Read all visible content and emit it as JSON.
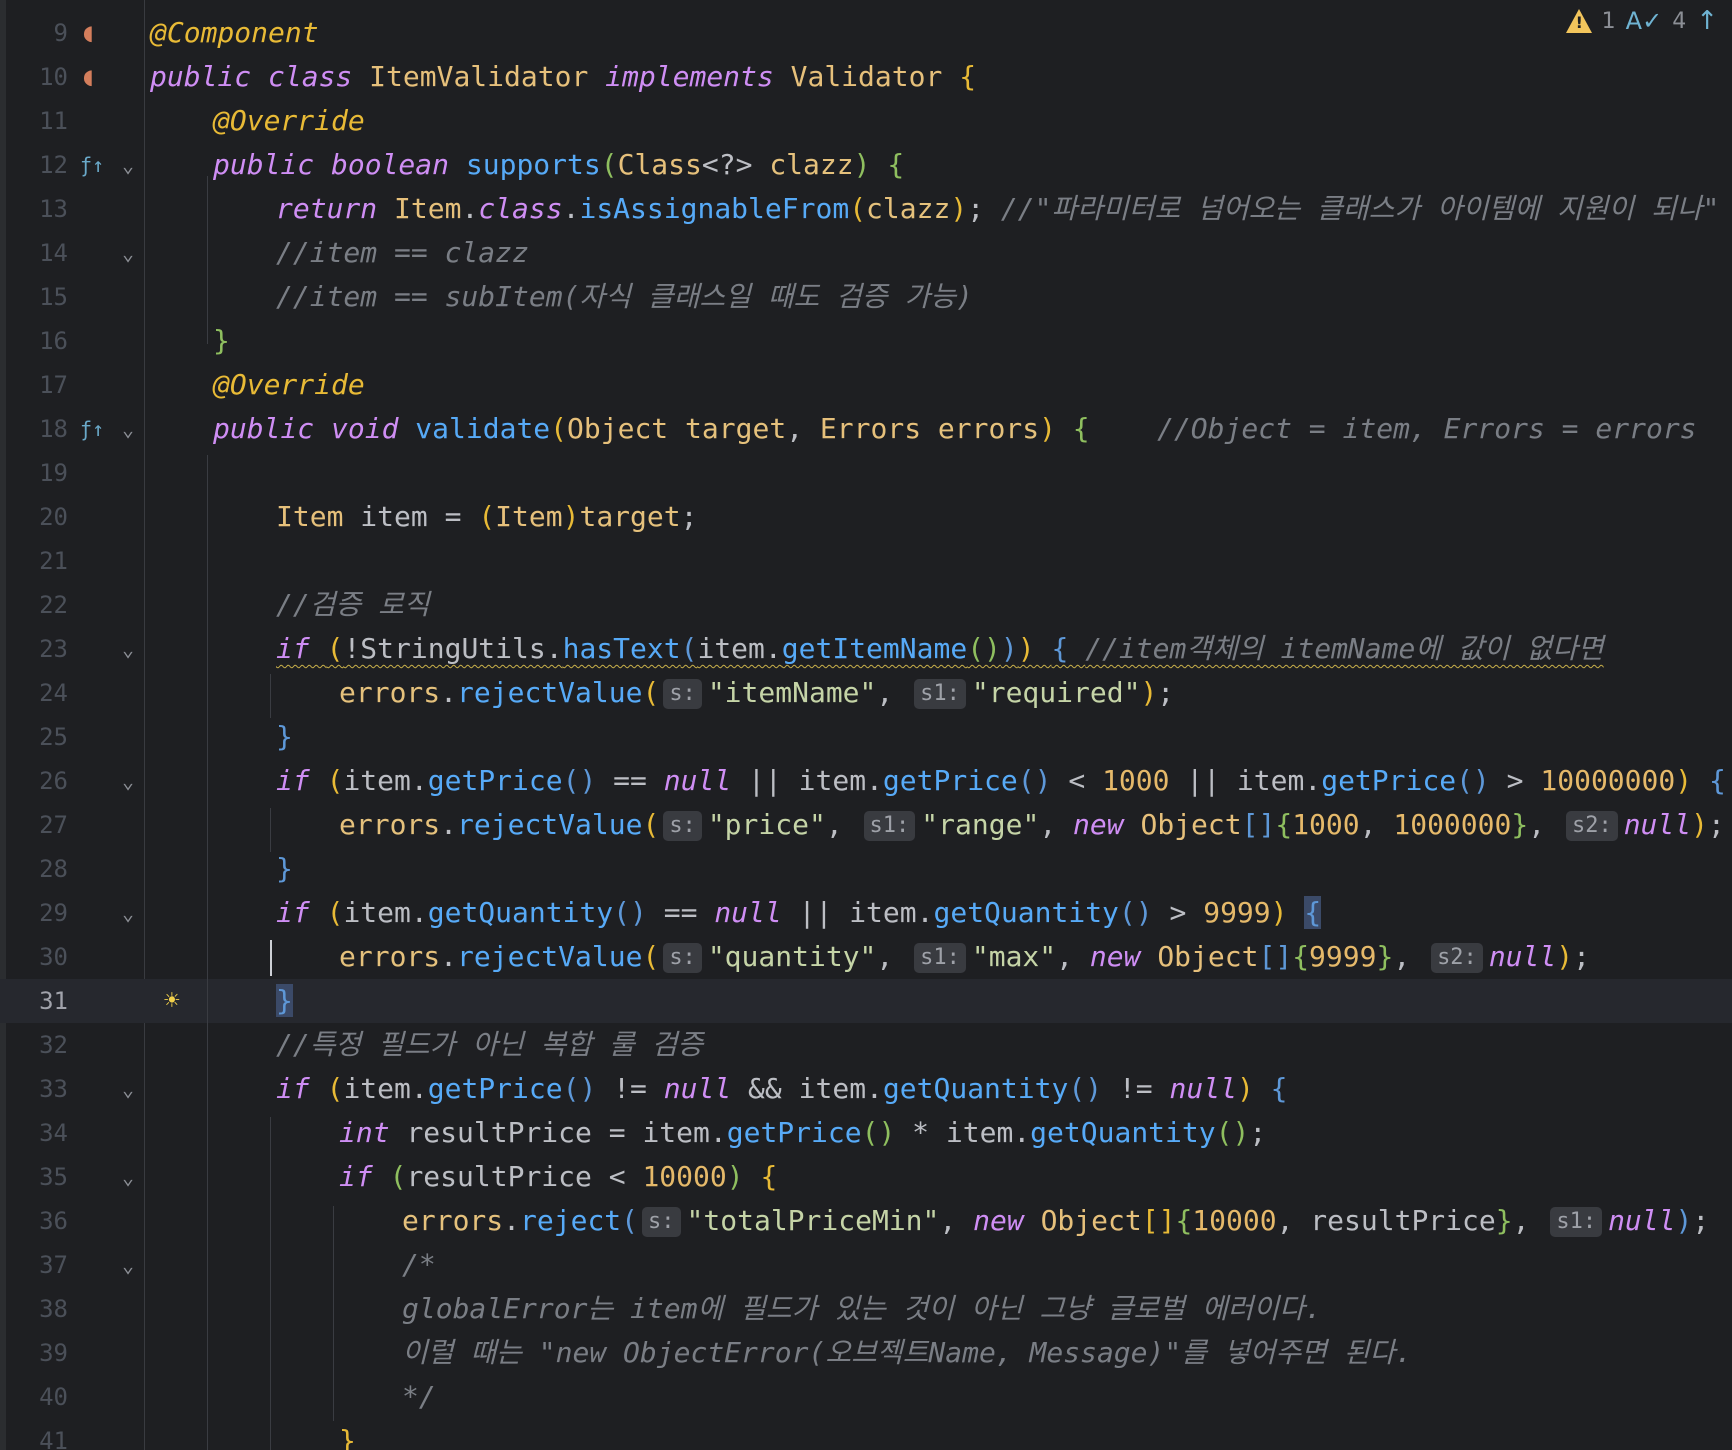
{
  "status": {
    "warnings": "1",
    "typos": "4",
    "warning_icon": "warning-triangle-icon",
    "typo_icon": "spellcheck-icon",
    "nav_icon": "arrow-up-icon"
  },
  "lines": [
    {
      "n": "9",
      "indent": 0,
      "gutter": "bean-icon",
      "fold": false,
      "tokens": [
        [
          "ann",
          "@Component"
        ]
      ]
    },
    {
      "n": "10",
      "indent": 0,
      "gutter": "bean-implemented-icon",
      "fold": false,
      "tokens": [
        [
          "kw",
          "public class "
        ],
        [
          "cls",
          "ItemValidator "
        ],
        [
          "kw",
          "implements "
        ],
        [
          "cls",
          "Validator "
        ],
        [
          "brace",
          "{"
        ]
      ]
    },
    {
      "n": "11",
      "indent": 1,
      "gutter": "",
      "fold": false,
      "tokens": [
        [
          "ann",
          "@Override"
        ]
      ]
    },
    {
      "n": "12",
      "indent": 1,
      "gutter": "override-method-icon",
      "fold": true,
      "tokens": [
        [
          "kw",
          "public boolean "
        ],
        [
          "fn",
          "supports"
        ],
        [
          "brace3",
          "("
        ],
        [
          "cls",
          "Class"
        ],
        [
          "plain",
          "<?> "
        ],
        [
          "param",
          "clazz"
        ],
        [
          "brace3",
          ") "
        ],
        [
          "brace3",
          "{"
        ]
      ]
    },
    {
      "n": "13",
      "indent": 2,
      "gutter": "",
      "fold": false,
      "tokens": [
        [
          "kw",
          "return "
        ],
        [
          "cls",
          "Item"
        ],
        [
          "plain",
          "."
        ],
        [
          "kw",
          "class"
        ],
        [
          "plain",
          "."
        ],
        [
          "fn",
          "isAssignableFrom"
        ],
        [
          "brace",
          "("
        ],
        [
          "param",
          "clazz"
        ],
        [
          "brace",
          ")"
        ],
        [
          "plain",
          "; "
        ],
        [
          "cm",
          "//\"파라미터로 넘어오는 클래스가 아이템에 지원이 되나\""
        ]
      ]
    },
    {
      "n": "14",
      "indent": 2,
      "gutter": "",
      "fold": true,
      "tokens": [
        [
          "cm",
          "//item == clazz"
        ]
      ]
    },
    {
      "n": "15",
      "indent": 2,
      "gutter": "",
      "fold": false,
      "tokens": [
        [
          "cm",
          "//item == subItem(자식 클래스일 때도 검증 가능)"
        ]
      ]
    },
    {
      "n": "16",
      "indent": 1,
      "gutter": "",
      "fold": false,
      "tokens": [
        [
          "brace3",
          "}"
        ]
      ]
    },
    {
      "n": "17",
      "indent": 1,
      "gutter": "",
      "fold": false,
      "tokens": [
        [
          "ann",
          "@Override"
        ]
      ]
    },
    {
      "n": "18",
      "indent": 1,
      "gutter": "override-method-icon",
      "fold": true,
      "tokens": [
        [
          "kw",
          "public void "
        ],
        [
          "fn",
          "validate"
        ],
        [
          "brace",
          "("
        ],
        [
          "cls",
          "Object "
        ],
        [
          "param",
          "target"
        ],
        [
          "plain",
          ", "
        ],
        [
          "cls",
          "Errors "
        ],
        [
          "param",
          "errors"
        ],
        [
          "brace",
          ") "
        ],
        [
          "brace3",
          "{"
        ],
        [
          "plain",
          "    "
        ],
        [
          "cm",
          "//Object = item, Errors = errors"
        ]
      ]
    },
    {
      "n": "19",
      "indent": 2,
      "gutter": "",
      "fold": false,
      "tokens": []
    },
    {
      "n": "20",
      "indent": 2,
      "gutter": "",
      "fold": false,
      "tokens": [
        [
          "cls",
          "Item "
        ],
        [
          "plain",
          "item = "
        ],
        [
          "brace",
          "("
        ],
        [
          "cls",
          "Item"
        ],
        [
          "brace",
          ")"
        ],
        [
          "param",
          "target"
        ],
        [
          "plain",
          ";"
        ]
      ]
    },
    {
      "n": "21",
      "indent": 2,
      "gutter": "",
      "fold": false,
      "tokens": []
    },
    {
      "n": "22",
      "indent": 2,
      "gutter": "",
      "fold": false,
      "tokens": [
        [
          "cm",
          "//검증 로직"
        ]
      ]
    },
    {
      "n": "23",
      "indent": 2,
      "gutter": "",
      "fold": true,
      "squiggle": true,
      "tokens": [
        [
          "kw",
          "if "
        ],
        [
          "brace",
          "("
        ],
        [
          "plain",
          "!StringUtils."
        ],
        [
          "fn",
          "hasText"
        ],
        [
          "brace2",
          "("
        ],
        [
          "plain",
          "item."
        ],
        [
          "fn",
          "getItemName"
        ],
        [
          "brace3",
          "()"
        ],
        [
          "brace2",
          ")"
        ],
        [
          "brace",
          ") "
        ],
        [
          "brace2",
          "{ "
        ],
        [
          "cm",
          "//item객체의 itemName에 값이 없다면"
        ]
      ]
    },
    {
      "n": "24",
      "indent": 3,
      "gutter": "",
      "fold": false,
      "tokens": [
        [
          "param",
          "errors"
        ],
        [
          "plain",
          "."
        ],
        [
          "fn",
          "rejectValue"
        ],
        [
          "brace",
          "("
        ],
        [
          "hint",
          "s:"
        ],
        [
          "str",
          "\"itemName\""
        ],
        [
          "plain",
          ", "
        ],
        [
          "hint",
          "s1:"
        ],
        [
          "str",
          "\"required\""
        ],
        [
          "brace",
          ")"
        ],
        [
          "plain",
          ";"
        ]
      ]
    },
    {
      "n": "25",
      "indent": 2,
      "gutter": "",
      "fold": false,
      "tokens": [
        [
          "brace2",
          "}"
        ]
      ]
    },
    {
      "n": "26",
      "indent": 2,
      "gutter": "",
      "fold": true,
      "tokens": [
        [
          "kw",
          "if "
        ],
        [
          "brace",
          "("
        ],
        [
          "plain",
          "item."
        ],
        [
          "fn",
          "getPrice"
        ],
        [
          "brace2",
          "()"
        ],
        [
          "plain",
          " == "
        ],
        [
          "kw",
          "null"
        ],
        [
          "plain",
          " || item."
        ],
        [
          "fn",
          "getPrice"
        ],
        [
          "brace2",
          "()"
        ],
        [
          "plain",
          " < "
        ],
        [
          "num",
          "1000"
        ],
        [
          "plain",
          " || item."
        ],
        [
          "fn",
          "getPrice"
        ],
        [
          "brace2",
          "()"
        ],
        [
          "plain",
          " > "
        ],
        [
          "num",
          "10000000"
        ],
        [
          "brace",
          ") "
        ],
        [
          "brace2",
          "{"
        ]
      ]
    },
    {
      "n": "27",
      "indent": 3,
      "gutter": "",
      "fold": false,
      "tokens": [
        [
          "param",
          "errors"
        ],
        [
          "plain",
          "."
        ],
        [
          "fn",
          "rejectValue"
        ],
        [
          "brace",
          "("
        ],
        [
          "hint",
          "s:"
        ],
        [
          "str",
          "\"price\""
        ],
        [
          "plain",
          ", "
        ],
        [
          "hint",
          "s1:"
        ],
        [
          "str",
          "\"range\""
        ],
        [
          "plain",
          ", "
        ],
        [
          "kw",
          "new "
        ],
        [
          "cls",
          "Object"
        ],
        [
          "brace2",
          "[]"
        ],
        [
          "brace3",
          "{"
        ],
        [
          "num",
          "1000"
        ],
        [
          "plain",
          ", "
        ],
        [
          "num",
          "1000000"
        ],
        [
          "brace3",
          "}"
        ],
        [
          "plain",
          ", "
        ],
        [
          "hint",
          "s2:"
        ],
        [
          "kw",
          "null"
        ],
        [
          "brace",
          ")"
        ],
        [
          "plain",
          ";"
        ]
      ]
    },
    {
      "n": "28",
      "indent": 2,
      "gutter": "",
      "fold": false,
      "tokens": [
        [
          "brace2",
          "}"
        ]
      ]
    },
    {
      "n": "29",
      "indent": 2,
      "gutter": "",
      "fold": true,
      "tokens": [
        [
          "kw",
          "if "
        ],
        [
          "brace",
          "("
        ],
        [
          "plain",
          "item."
        ],
        [
          "fn",
          "getQuantity"
        ],
        [
          "brace2",
          "()"
        ],
        [
          "plain",
          " == "
        ],
        [
          "kw",
          "null"
        ],
        [
          "plain",
          " || item."
        ],
        [
          "fn",
          "getQuantity"
        ],
        [
          "brace2",
          "()"
        ],
        [
          "plain",
          " > "
        ],
        [
          "num",
          "9999"
        ],
        [
          "brace",
          ") "
        ],
        [
          "bracehl",
          "{"
        ]
      ]
    },
    {
      "n": "30",
      "indent": 3,
      "gutter": "",
      "fold": false,
      "tokens": [
        [
          "param",
          "errors"
        ],
        [
          "plain",
          "."
        ],
        [
          "fn",
          "rejectValue"
        ],
        [
          "brace",
          "("
        ],
        [
          "hint",
          "s:"
        ],
        [
          "str",
          "\"quantity\""
        ],
        [
          "plain",
          ", "
        ],
        [
          "hint",
          "s1:"
        ],
        [
          "str",
          "\"max\""
        ],
        [
          "plain",
          ", "
        ],
        [
          "kw",
          "new "
        ],
        [
          "cls",
          "Object"
        ],
        [
          "brace2",
          "[]"
        ],
        [
          "brace3",
          "{"
        ],
        [
          "num",
          "9999"
        ],
        [
          "brace3",
          "}"
        ],
        [
          "plain",
          ", "
        ],
        [
          "hint",
          "s2:"
        ],
        [
          "kw",
          "null"
        ],
        [
          "brace",
          ")"
        ],
        [
          "plain",
          ";"
        ]
      ]
    },
    {
      "n": "31",
      "indent": 2,
      "gutter": "bulb-icon",
      "fold": false,
      "current": true,
      "tokens": [
        [
          "bracehl",
          "}"
        ]
      ]
    },
    {
      "n": "32",
      "indent": 2,
      "gutter": "",
      "fold": false,
      "tokens": [
        [
          "cm",
          "//특정 필드가 아닌 복합 룰 검증"
        ]
      ]
    },
    {
      "n": "33",
      "indent": 2,
      "gutter": "",
      "fold": true,
      "tokens": [
        [
          "kw",
          "if "
        ],
        [
          "brace",
          "("
        ],
        [
          "plain",
          "item."
        ],
        [
          "fn",
          "getPrice"
        ],
        [
          "brace2",
          "()"
        ],
        [
          "plain",
          " != "
        ],
        [
          "kw",
          "null"
        ],
        [
          "plain",
          " && item."
        ],
        [
          "fn",
          "getQuantity"
        ],
        [
          "brace2",
          "()"
        ],
        [
          "plain",
          " != "
        ],
        [
          "kw",
          "null"
        ],
        [
          "brace",
          ") "
        ],
        [
          "brace2",
          "{"
        ]
      ]
    },
    {
      "n": "34",
      "indent": 3,
      "gutter": "",
      "fold": false,
      "tokens": [
        [
          "kw",
          "int "
        ],
        [
          "plain",
          "resultPrice = item."
        ],
        [
          "fn",
          "getPrice"
        ],
        [
          "brace3",
          "()"
        ],
        [
          "plain",
          " * item."
        ],
        [
          "fn",
          "getQuantity"
        ],
        [
          "brace3",
          "()"
        ],
        [
          "plain",
          ";"
        ]
      ]
    },
    {
      "n": "35",
      "indent": 3,
      "gutter": "",
      "fold": true,
      "tokens": [
        [
          "kw",
          "if "
        ],
        [
          "brace3",
          "("
        ],
        [
          "plain",
          "resultPrice < "
        ],
        [
          "num",
          "10000"
        ],
        [
          "brace3",
          ") "
        ],
        [
          "brace",
          "{"
        ]
      ]
    },
    {
      "n": "36",
      "indent": 4,
      "gutter": "",
      "fold": false,
      "tokens": [
        [
          "param",
          "errors"
        ],
        [
          "plain",
          "."
        ],
        [
          "fn",
          "reject"
        ],
        [
          "brace2",
          "("
        ],
        [
          "hint",
          "s:"
        ],
        [
          "str",
          "\"totalPriceMin\""
        ],
        [
          "plain",
          ", "
        ],
        [
          "kw",
          "new "
        ],
        [
          "cls",
          "Object"
        ],
        [
          "brace",
          "[]"
        ],
        [
          "brace3",
          "{"
        ],
        [
          "num",
          "10000"
        ],
        [
          "plain",
          ", resultPrice"
        ],
        [
          "brace3",
          "}"
        ],
        [
          "plain",
          ", "
        ],
        [
          "hint",
          "s1:"
        ],
        [
          "kw",
          "null"
        ],
        [
          "brace2",
          ")"
        ],
        [
          "plain",
          ";"
        ]
      ]
    },
    {
      "n": "37",
      "indent": 4,
      "gutter": "",
      "fold": true,
      "tokens": [
        [
          "cm",
          "/*"
        ]
      ]
    },
    {
      "n": "38",
      "indent": 4,
      "gutter": "",
      "fold": false,
      "tokens": [
        [
          "cm",
          "globalError는 item에 필드가 있는 것이 아닌 그냥 글로벌 에러이다."
        ]
      ]
    },
    {
      "n": "39",
      "indent": 4,
      "gutter": "",
      "fold": false,
      "tokens": [
        [
          "cm",
          "이럴 때는 \"new ObjectError(오브젝트Name, Message)\"를 넣어주면 된다."
        ]
      ]
    },
    {
      "n": "40",
      "indent": 4,
      "gutter": "",
      "fold": false,
      "tokens": [
        [
          "cm",
          "*/"
        ]
      ]
    },
    {
      "n": "41",
      "indent": 3,
      "gutter": "",
      "fold": false,
      "tokens": [
        [
          "brace",
          "}"
        ]
      ]
    }
  ]
}
